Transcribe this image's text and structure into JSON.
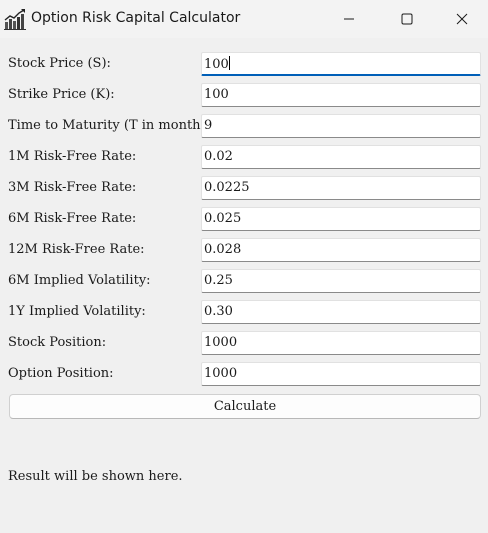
{
  "window": {
    "title": "Option Risk Capital Calculator",
    "controls": {
      "minimize_icon": "minimize-icon",
      "maximize_icon": "maximize-icon",
      "close_icon": "close-icon"
    }
  },
  "form": {
    "fields": [
      {
        "label": "Stock Price (S):",
        "value": "100",
        "focused": true
      },
      {
        "label": "Strike Price (K):",
        "value": "100"
      },
      {
        "label": "Time to Maturity (T in months):",
        "value": "9"
      },
      {
        "label": "1M Risk-Free Rate:",
        "value": "0.02"
      },
      {
        "label": "3M Risk-Free Rate:",
        "value": "0.0225"
      },
      {
        "label": "6M Risk-Free Rate:",
        "value": "0.025"
      },
      {
        "label": "12M Risk-Free Rate:",
        "value": "0.028"
      },
      {
        "label": "6M Implied Volatility:",
        "value": "0.25"
      },
      {
        "label": "1Y Implied Volatility:",
        "value": "0.30"
      },
      {
        "label": "Stock Position:",
        "value": "1000"
      },
      {
        "label": "Option Position:",
        "value": "1000"
      }
    ],
    "calculate_label": "Calculate"
  },
  "result": {
    "text": "Result will be shown here."
  },
  "colors": {
    "focus_accent": "#005fb8",
    "background": "#f0f0f0"
  }
}
